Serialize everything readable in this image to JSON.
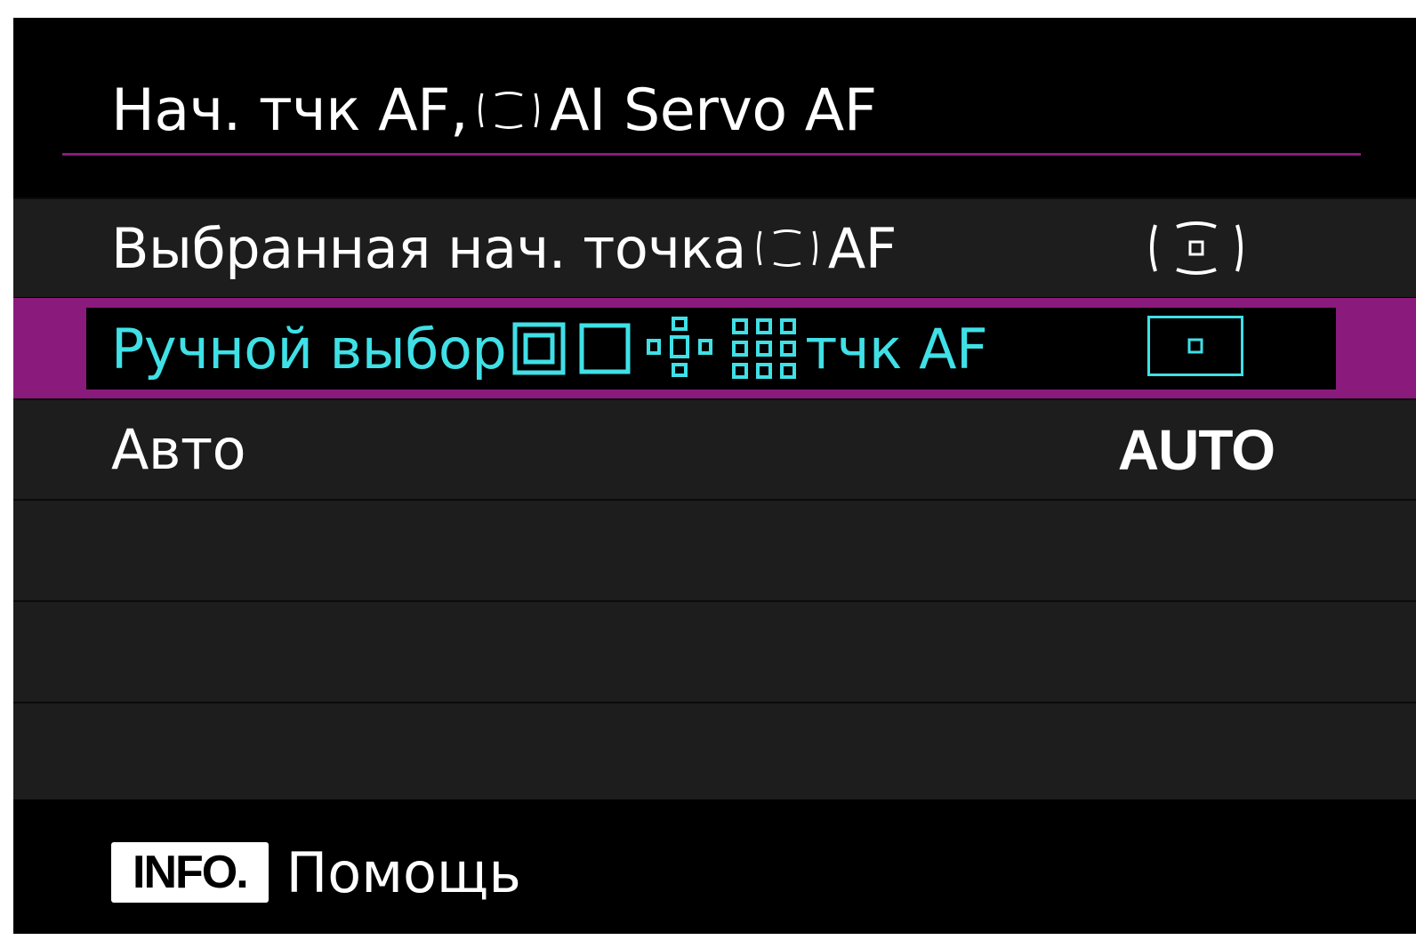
{
  "header": {
    "title_prefix": "Нач. тчк AF,",
    "title_icon": "servo-af-area-icon",
    "title_suffix": "AI Servo AF"
  },
  "menu": {
    "items": [
      {
        "label_prefix": "Выбранная нач. точка",
        "label_icon": "servo-af-area-icon",
        "label_suffix": "AF",
        "value_icon": "servo-af-point-icon",
        "selected": false
      },
      {
        "label_prefix": "Ручной выбор",
        "label_icons": [
          "spot-af-icon",
          "single-point-af-icon",
          "zone-expand-af-icon",
          "expand-surround-af-icon"
        ],
        "label_suffix": "тчк AF",
        "value_icon": "single-point-af-frame-icon",
        "selected": true
      },
      {
        "label": "Авто",
        "value": "AUTO",
        "selected": false
      }
    ]
  },
  "footer": {
    "button_label": "INFO.",
    "help_label": "Помощь"
  },
  "colors": {
    "background": "#000000",
    "row": "#1d1d1d",
    "accent": "#8a1a7c",
    "selected_text": "#3fe0e6",
    "text": "#ffffff"
  }
}
